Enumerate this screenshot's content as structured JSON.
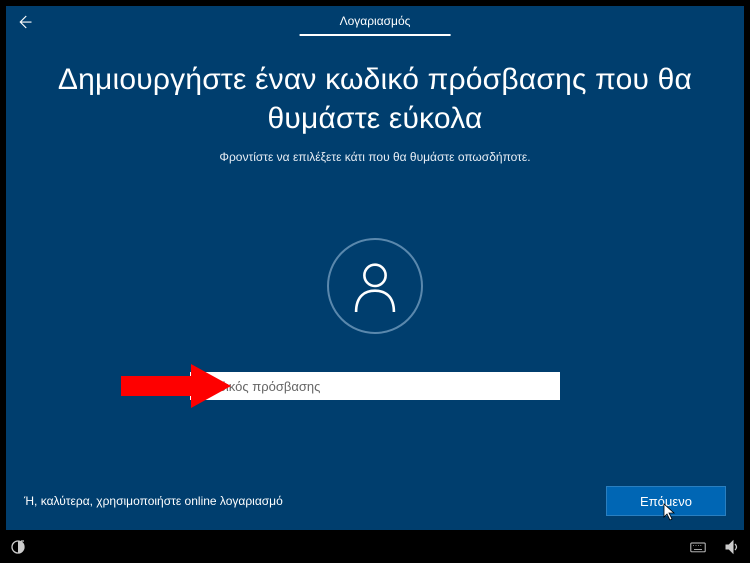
{
  "header": {
    "tab_label": "Λογαριασμός"
  },
  "main": {
    "title": "Δημιουργήστε έναν κωδικό πρόσβασης που θα θυμάστε εύκολα",
    "subtitle": "Φροντίστε να επιλέξετε κάτι που θα θυμάστε οπωσδήποτε.",
    "password_placeholder": "Κωδικός πρόσβασης",
    "password_value": ""
  },
  "footer": {
    "online_link": "Ή, καλύτερα, χρησιμοποιήστε online λογαριασμό",
    "next_button": "Επόμενο"
  },
  "colors": {
    "panel_bg": "#003e6e",
    "accent": "#0066b4",
    "arrow": "#fe0000"
  }
}
